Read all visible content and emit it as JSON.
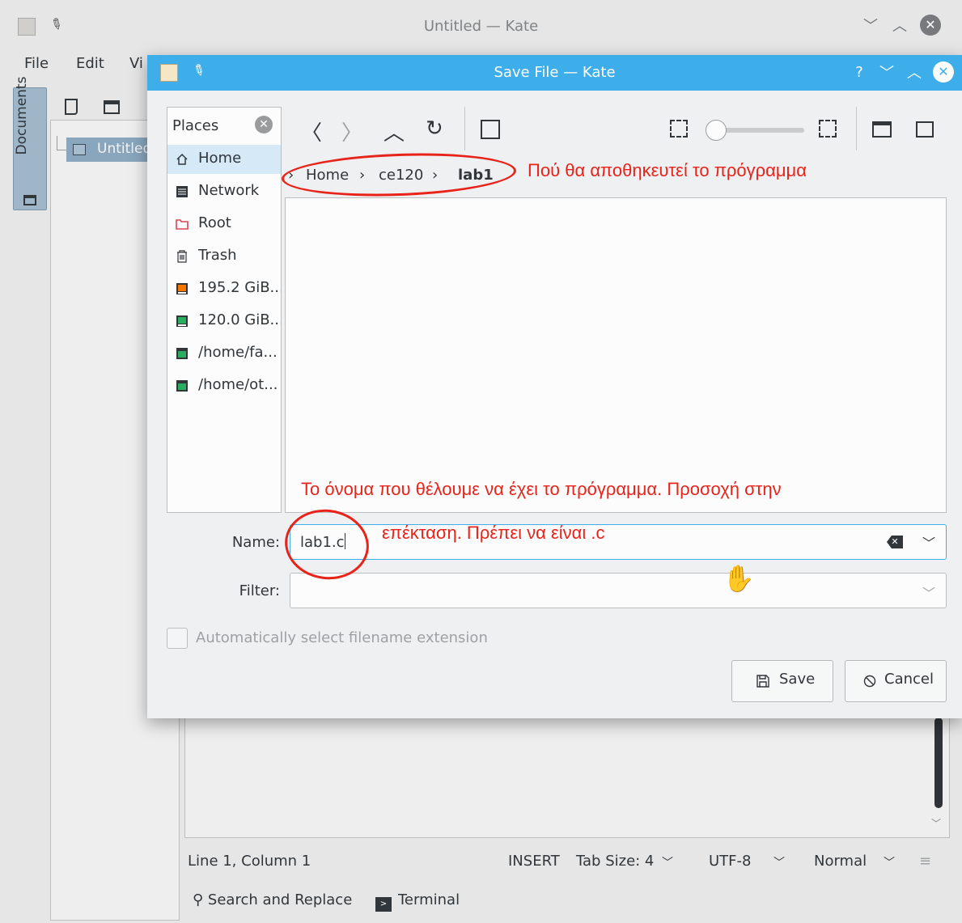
{
  "kate": {
    "title": "Untitled  — Kate",
    "menu": [
      "File",
      "Edit",
      "Vi"
    ],
    "side_tab_label": "Documents",
    "document_name": "Untitled",
    "status": {
      "position": "Line 1, Column 1",
      "mode": "INSERT",
      "tab_size": "Tab Size: 4",
      "encoding": "UTF-8",
      "syntax": "Normal"
    },
    "tools": {
      "search_replace": "Search and Replace",
      "terminal": "Terminal"
    }
  },
  "dialog": {
    "title": "Save File — Kate",
    "places": {
      "header": "Places",
      "items": [
        {
          "label": "Home",
          "icon": "home-icon",
          "selected": true
        },
        {
          "label": "Network",
          "icon": "network-icon"
        },
        {
          "label": "Root",
          "icon": "root-folder-icon"
        },
        {
          "label": "Trash",
          "icon": "trash-icon"
        },
        {
          "label": "195.2 GiB...",
          "icon": "drive-icon"
        },
        {
          "label": "120.0 GiB...",
          "icon": "drive-icon"
        },
        {
          "label": "/home/fa...",
          "icon": "drive-icon"
        },
        {
          "label": "/home/ot...",
          "icon": "drive-icon"
        }
      ]
    },
    "breadcrumb": [
      "Home",
      "ce120",
      "lab1"
    ],
    "name_label": "Name:",
    "name_value": "lab1.c",
    "filter_label": "Filter:",
    "auto_extension_label": "Automatically select filename extension",
    "save_label": "Save",
    "cancel_label": "Cancel",
    "accent_color": "#3daee9"
  },
  "annotations": {
    "location_note": "Πού θα αποθηκευτεί το πρόγραμμα",
    "name_note_line1": "Το όνομα που θέλουμε να έχει το πρόγραμμα. Προσοχή στην",
    "name_note_line2": "επέκταση. Πρέπει να είναι .c",
    "color": "#e8231a"
  }
}
